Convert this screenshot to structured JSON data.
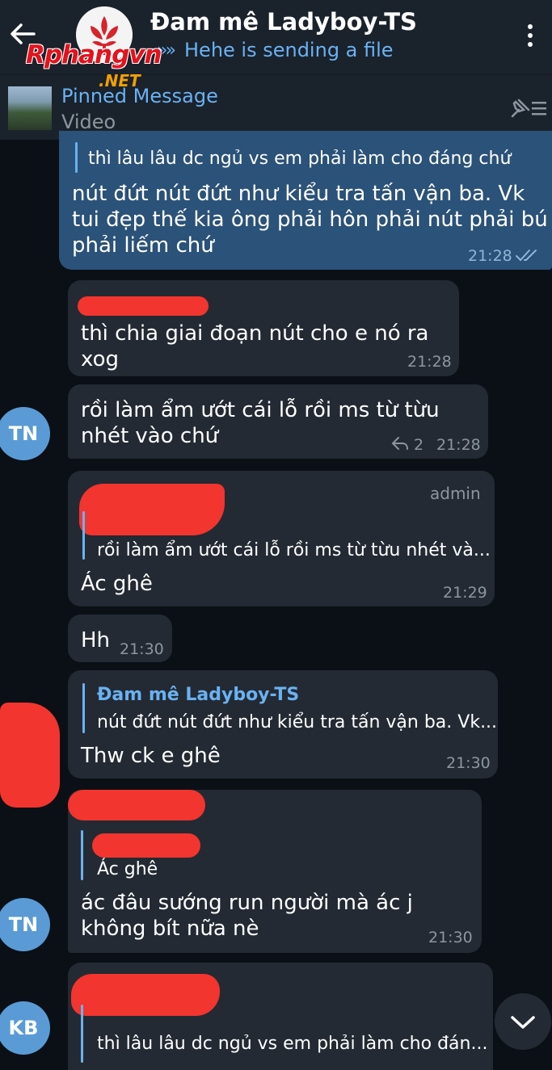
{
  "header": {
    "title": "Đam mê Ladyboy-TS",
    "status": "Hehe is sending a file",
    "watermark": "Rphangvn",
    "watermark_suffix": ".NET"
  },
  "pinned": {
    "title": "Pinned Message",
    "subtitle": "Video"
  },
  "messages": [
    {
      "reply_text": "thì lâu lâu dc ngủ vs em phải làm cho đáng chứ",
      "text": "nút đứt nút đứt như kiểu tra tấn vận ba. Vk tui đẹp thế kia ông phải hôn phải nút phải bú phải liếm chứ",
      "time": "21:28"
    },
    {
      "text": "thì chia giai đoạn nút cho e nó ra xog",
      "time": "21:28"
    },
    {
      "text": "rồi làm ẩm ướt cái lỗ rồi ms từ từu nhét vào chứ",
      "replies": "2",
      "time": "21:28",
      "avatar": "TN"
    },
    {
      "badge": "admin",
      "reply_text": "rồi làm ẩm ướt cái lỗ rồi ms từ từu nhét và...",
      "text": "Ác ghê",
      "time": "21:29"
    },
    {
      "text": "Hh",
      "time": "21:30"
    },
    {
      "reply_name": "Đam mê Ladyboy-TS",
      "reply_text": "nút đứt nút đứt như kiểu tra tấn vận ba. Vk...",
      "text": "Thw ck e ghê",
      "time": "21:30"
    },
    {
      "reply_text": "Ác ghê",
      "text": "ác đâu sướng run người mà ác j không bít nữa nè",
      "time": "21:30",
      "avatar": "TN"
    },
    {
      "reply_text": "thì lâu lâu dc ngủ vs em phải làm cho đán...",
      "avatar": "KB"
    }
  ],
  "colors": {
    "accent": "#6ab2f2",
    "outgoing": "#2b5278",
    "incoming": "#232a33",
    "background": "#0b1016",
    "redaction": "#f2352e",
    "avatar": "#5a9bd5"
  }
}
